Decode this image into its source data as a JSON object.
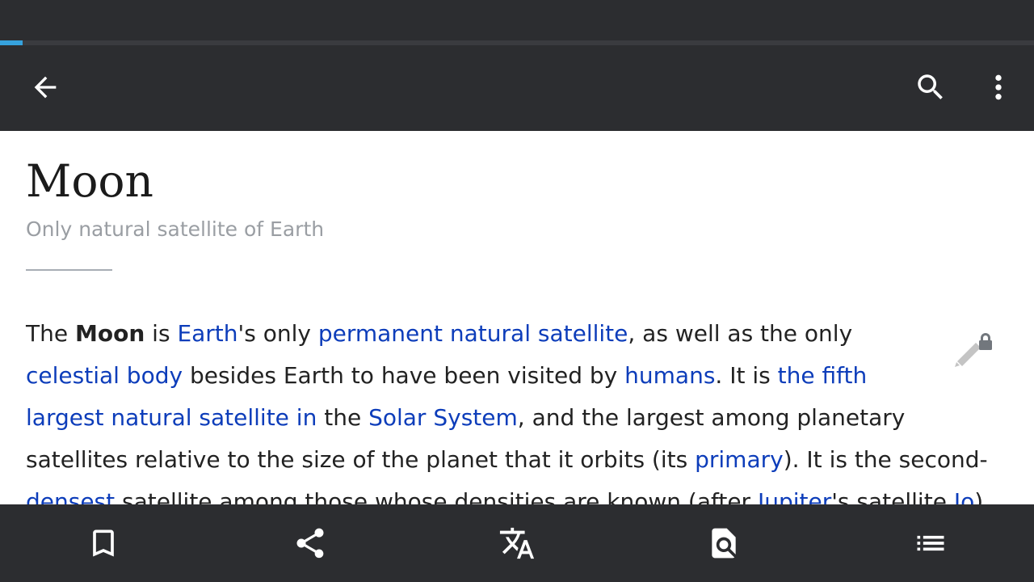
{
  "progress": {
    "percent": 2.2,
    "color": "#36a2dd"
  },
  "toolbar": {
    "back_icon": "arrow-left-icon",
    "search_icon": "search-icon",
    "more_icon": "more-vert-icon"
  },
  "article": {
    "title": "Moon",
    "description": "Only natural satellite of Earth",
    "lead_lines": [
      [
        {
          "t": "The "
        },
        {
          "t": "Moon",
          "bold": true
        },
        {
          "t": " is "
        },
        {
          "t": "Earth",
          "link": true
        },
        {
          "t": "'s only "
        },
        {
          "t": "permanent natural satellite",
          "link": true
        },
        {
          "t": ", as well as the only"
        }
      ],
      [
        {
          "t": "celestial body",
          "link": true
        },
        {
          "t": " besides Earth to have been visited by "
        },
        {
          "t": "humans",
          "link": true
        },
        {
          "t": ". It is "
        },
        {
          "t": "the fifth",
          "link": true
        }
      ],
      [
        {
          "t": "largest natural satellite in",
          "link": true
        },
        {
          "t": " the "
        },
        {
          "t": "Solar System",
          "link": true
        },
        {
          "t": ", and the largest among planetary"
        }
      ],
      [
        {
          "t": "satellites relative to the size of the planet that it orbits (its "
        },
        {
          "t": "primary",
          "link": true
        },
        {
          "t": "). It is the second-"
        }
      ],
      [
        {
          "t": "densest",
          "link": true
        },
        {
          "t": " satellite among those whose densities are known (after "
        },
        {
          "t": "Jupiter",
          "link": true
        },
        {
          "t": "'s satellite "
        },
        {
          "t": "Io",
          "link": true
        },
        {
          "t": ")"
        }
      ]
    ],
    "edit_icon": "edit-locked-icon"
  },
  "bottom_bar": {
    "items": [
      {
        "name": "bookmark",
        "icon": "bookmark-icon"
      },
      {
        "name": "share",
        "icon": "share-icon"
      },
      {
        "name": "translate",
        "icon": "translate-icon"
      },
      {
        "name": "find-in-page",
        "icon": "find-in-page-icon"
      },
      {
        "name": "contents",
        "icon": "table-of-contents-icon"
      }
    ]
  },
  "colors": {
    "bar_background": "#2c2d30",
    "link": "#0d3dba",
    "text": "#222222",
    "description": "#9a9ea3"
  }
}
